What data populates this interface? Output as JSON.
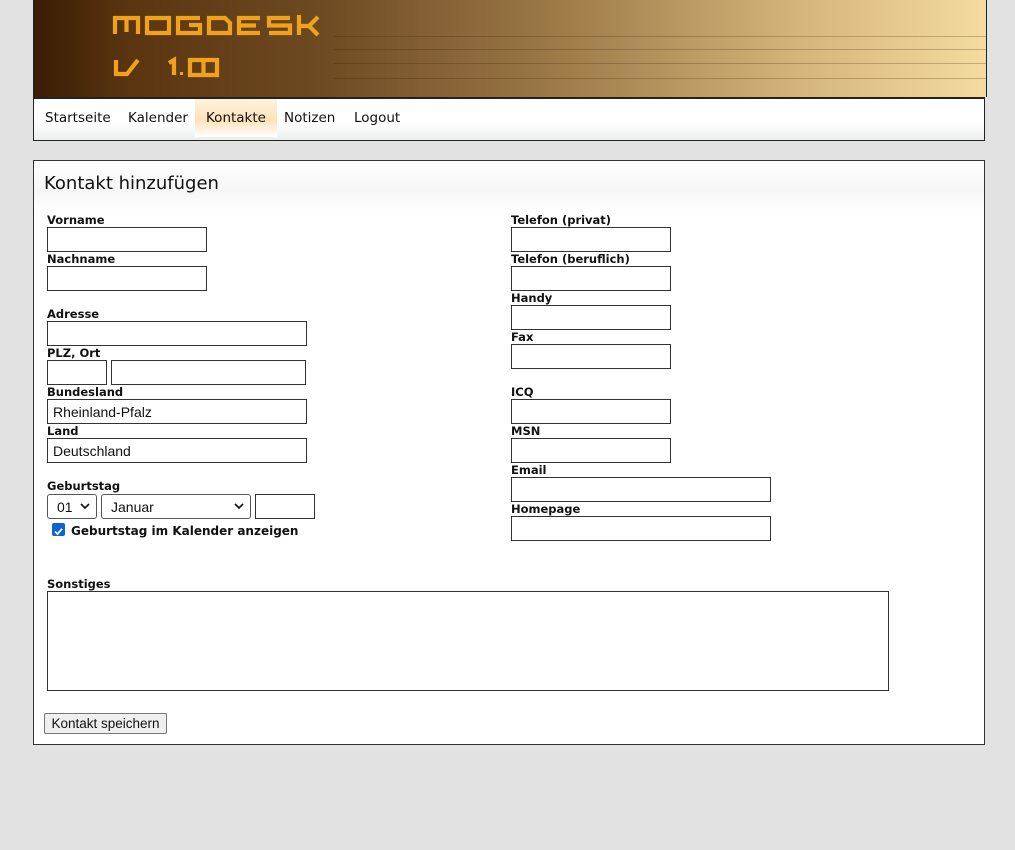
{
  "header": {
    "logo_line1": "MOGDESK",
    "logo_line2": "V 1.00"
  },
  "nav": {
    "items": [
      {
        "label": "Startseite"
      },
      {
        "label": "Kalender"
      },
      {
        "label": "Kontakte",
        "active": true
      },
      {
        "label": "Notizen"
      },
      {
        "label": "Logout"
      }
    ]
  },
  "form": {
    "title": "Kontakt hinzufügen",
    "fields": {
      "vorname": {
        "label": "Vorname",
        "value": ""
      },
      "nachname": {
        "label": "Nachname",
        "value": ""
      },
      "adresse": {
        "label": "Adresse",
        "value": ""
      },
      "plz_ort": {
        "label": "PLZ, Ort",
        "plz": "",
        "ort": ""
      },
      "bundesland": {
        "label": "Bundesland",
        "value": "Rheinland-Pfalz"
      },
      "land": {
        "label": "Land",
        "value": "Deutschland"
      },
      "geburtstag": {
        "label": "Geburtstag",
        "day": "01",
        "month": "Januar",
        "year": ""
      },
      "tel_privat": {
        "label": "Telefon (privat)",
        "value": ""
      },
      "tel_beruflich": {
        "label": "Telefon (beruflich)",
        "value": ""
      },
      "handy": {
        "label": "Handy",
        "value": ""
      },
      "fax": {
        "label": "Fax",
        "value": ""
      },
      "icq": {
        "label": "ICQ",
        "value": ""
      },
      "msn": {
        "label": "MSN",
        "value": ""
      },
      "email": {
        "label": "Email",
        "value": ""
      },
      "homepage": {
        "label": "Homepage",
        "value": ""
      },
      "sonstiges": {
        "label": "Sonstiges",
        "value": ""
      }
    },
    "checkbox": {
      "label": "Geburtstag im Kalender anzeigen",
      "checked": true
    },
    "save_label": "Kontakt speichern"
  },
  "colors": {
    "page_bg": "#e2e2e2",
    "logo_text": "#f0a21a",
    "header_dark": "#3a1d05",
    "header_light": "#f4dba0",
    "nav_active": "#fde2b8",
    "checkbox": "#0b63d6"
  }
}
